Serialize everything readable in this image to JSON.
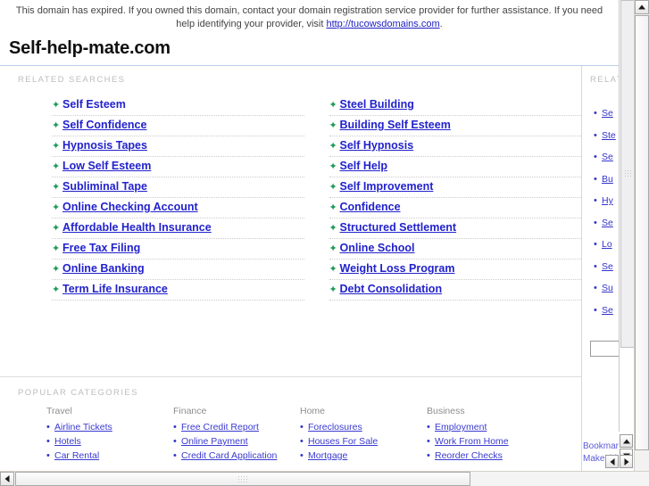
{
  "notice": {
    "text_before": "This domain has expired. If you owned this domain, contact your domain registration service provider for further assistance. If you need help identifying your provider, visit ",
    "link_text": "http://tucowsdomains.com",
    "text_after": "."
  },
  "brand": {
    "title": "Self-help-mate.com"
  },
  "related_searches": {
    "label": "RELATED SEARCHES",
    "left_column": [
      "Self Esteem",
      "Self Confidence",
      "Hypnosis Tapes",
      "Low Self Esteem",
      "Subliminal Tape",
      "Online Checking Account",
      "Affordable Health Insurance",
      "Free Tax Filing",
      "Online Banking",
      "Term Life Insurance"
    ],
    "right_column": [
      "Steel Building",
      "Building Self Esteem",
      "Self Hypnosis",
      "Self Help",
      "Self Improvement",
      "Confidence",
      "Structured Settlement",
      "Online School",
      "Weight Loss Program",
      "Debt Consolidation"
    ],
    "bullet_glyph": "✦",
    "bullet_color": "#1f9a5a",
    "link_color": "#2222cc"
  },
  "popular_categories": {
    "label": "POPULAR CATEGORIES",
    "columns": [
      {
        "heading": "Travel",
        "items": [
          "Airline Tickets",
          "Hotels",
          "Car Rental"
        ]
      },
      {
        "heading": "Finance",
        "items": [
          "Free Credit Report",
          "Online Payment",
          "Credit Card Application"
        ]
      },
      {
        "heading": "Home",
        "items": [
          "Foreclosures",
          "Houses For Sale",
          "Mortgage"
        ]
      },
      {
        "heading": "Business",
        "items": [
          "Employment",
          "Work From Home",
          "Reorder Checks"
        ]
      }
    ],
    "bullet_glyph": "•",
    "link_color": "#3a3ad0"
  },
  "sidebar": {
    "label": "RELATED",
    "items": [
      "Se",
      "Ste",
      "Se",
      "Bu",
      "Hy",
      "Se",
      "Lo",
      "Se",
      "Su",
      "Se"
    ],
    "search_value": "",
    "search_placeholder": "",
    "footer_links": [
      "Bookmark",
      "Make this"
    ],
    "bullet_glyph": "•"
  },
  "scrollbars": {
    "up_arrow": "▲",
    "down_arrow": "▼",
    "left_arrow": "◀",
    "right_arrow": "▶"
  }
}
